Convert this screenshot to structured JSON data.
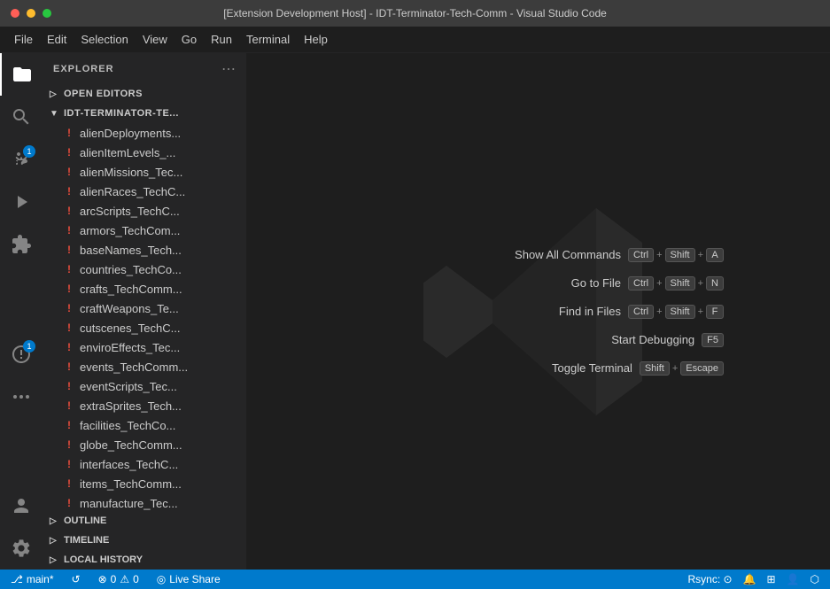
{
  "titlebar": {
    "title": "[Extension Development Host] - IDT-Terminator-Tech-Comm - Visual Studio Code",
    "min_btn": "−",
    "max_btn": "□",
    "close_btn": "✕"
  },
  "menubar": {
    "items": [
      {
        "id": "file",
        "label": "File"
      },
      {
        "id": "edit",
        "label": "Edit"
      },
      {
        "id": "selection",
        "label": "Selection"
      },
      {
        "id": "view",
        "label": "View"
      },
      {
        "id": "go",
        "label": "Go"
      },
      {
        "id": "run",
        "label": "Run"
      },
      {
        "id": "terminal",
        "label": "Terminal"
      },
      {
        "id": "help",
        "label": "Help"
      }
    ]
  },
  "sidebar": {
    "header": "Explorer",
    "header_menu": "⋯",
    "sections": {
      "open_editors": "Open Editors",
      "project": "IDT-TERMINATOR-TE...",
      "outline": "Outline",
      "timeline": "Timeline",
      "local_history": "Local History"
    }
  },
  "files": [
    {
      "name": "alienDeployments...",
      "icon": "!"
    },
    {
      "name": "alienItemLevels_...",
      "icon": "!"
    },
    {
      "name": "alienMissions_Tec...",
      "icon": "!"
    },
    {
      "name": "alienRaces_TechC...",
      "icon": "!"
    },
    {
      "name": "arcScripts_TechC...",
      "icon": "!"
    },
    {
      "name": "armors_TechCom...",
      "icon": "!"
    },
    {
      "name": "baseNames_Tech...",
      "icon": "!"
    },
    {
      "name": "countries_TechCo...",
      "icon": "!"
    },
    {
      "name": "crafts_TechComm...",
      "icon": "!"
    },
    {
      "name": "craftWeapons_Te...",
      "icon": "!"
    },
    {
      "name": "cutscenes_TechC...",
      "icon": "!"
    },
    {
      "name": "enviroEffects_Tec...",
      "icon": "!"
    },
    {
      "name": "events_TechComm...",
      "icon": "!"
    },
    {
      "name": "eventScripts_Tec...",
      "icon": "!"
    },
    {
      "name": "extraSprites_Tech...",
      "icon": "!"
    },
    {
      "name": "facilities_TechCo...",
      "icon": "!"
    },
    {
      "name": "globe_TechComm...",
      "icon": "!"
    },
    {
      "name": "interfaces_TechC...",
      "icon": "!"
    },
    {
      "name": "items_TechComm...",
      "icon": "!"
    },
    {
      "name": "manufacture_Tec...",
      "icon": "!"
    }
  ],
  "shortcuts": [
    {
      "label": "Show All Commands",
      "keys": [
        "Ctrl",
        "+",
        "Shift",
        "+",
        "A"
      ]
    },
    {
      "label": "Go to File",
      "keys": [
        "Ctrl",
        "+",
        "Shift",
        "+",
        "N"
      ]
    },
    {
      "label": "Find in Files",
      "keys": [
        "Ctrl",
        "+",
        "Shift",
        "+",
        "F"
      ]
    },
    {
      "label": "Start Debugging",
      "keys": [
        "F5"
      ]
    },
    {
      "label": "Toggle Terminal",
      "keys": [
        "Shift",
        "+",
        "Escape"
      ]
    }
  ],
  "statusbar": {
    "branch": "⎇ main*",
    "sync": "↺",
    "errors": "⊗ 0",
    "warnings": "⚠ 0",
    "live_share": "Live Share",
    "rsync": "Rsync: ⊙",
    "icons_right": [
      "⬤",
      "⬤",
      "⬤",
      "⊙"
    ]
  },
  "activity": {
    "icons": [
      {
        "id": "files",
        "symbol": "📋",
        "active": true
      },
      {
        "id": "search",
        "symbol": "🔍"
      },
      {
        "id": "source-control",
        "symbol": "⎇",
        "badge": "1"
      },
      {
        "id": "run",
        "symbol": "▷"
      },
      {
        "id": "extensions",
        "symbol": "⊞"
      },
      {
        "id": "remote",
        "symbol": "⬡",
        "badge": "1"
      },
      {
        "id": "more",
        "symbol": "···"
      }
    ],
    "bottom": [
      {
        "id": "account",
        "symbol": "👤"
      },
      {
        "id": "settings",
        "symbol": "⚙"
      }
    ]
  }
}
